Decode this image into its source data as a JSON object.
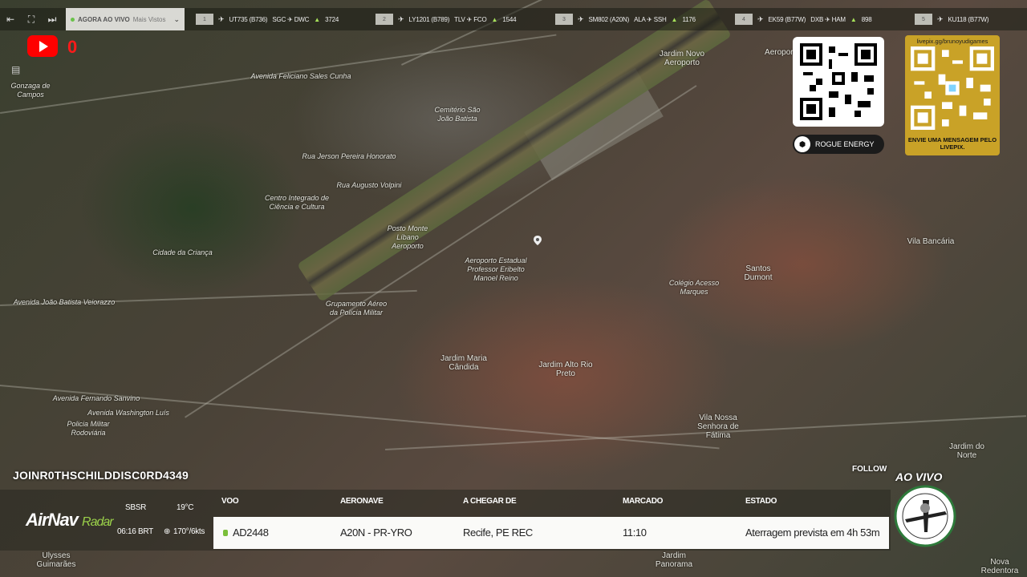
{
  "topbar": {
    "now_live_label": "AGORA AO VIVO",
    "now_live_more": "Mais Vistos",
    "flights": [
      {
        "index": "1",
        "callsign": "UT735 (B736)",
        "route": "SGC ✈ DWC",
        "altitude": "3724"
      },
      {
        "index": "2",
        "callsign": "LY1201 (B789)",
        "route": "TLV ✈ FCO",
        "altitude": "1544"
      },
      {
        "index": "3",
        "callsign": "SM802 (A20N)",
        "route": "ALA ✈ SSH",
        "altitude": "1176"
      },
      {
        "index": "4",
        "callsign": "EK59 (B77W)",
        "route": "DXB ✈ HAM",
        "altitude": "898"
      },
      {
        "index": "5",
        "callsign": "KU118 (B77W)",
        "route": "",
        "altitude": ""
      }
    ]
  },
  "youtube": {
    "count": "0"
  },
  "map_labels": [
    "Gonzaga de Campos",
    "Jardim Novo Aeroporto",
    "Avenida Feliciano Sales Cunha",
    "Cemitério São João Batista",
    "Centro Integrado de Ciência e Cultura",
    "Cidade da Criança",
    "Posto Monte Líbano Aeroporto",
    "Aeroporto Estadual Professor Eribelto Manoel Reino",
    "Santos Dumont",
    "Colégio Acesso Marques",
    "Vila Bancária",
    "Grupamento Aéreo da Polícia Militar",
    "Jardim Maria Cândida",
    "Jardim Alto Rio Preto",
    "Vila Nossa Senhora de Fátima",
    "Avenida Fernando Sanvino",
    "Jardim do Norte",
    "Jardim Panorama",
    "Nova Redentora",
    "Ulysses Guimarães",
    "Avenida João Batista Veiorazzo",
    "Rua Jerson Pereira Honorato",
    "Rua Augusto Volpini",
    "Policia Militar Rodoviária",
    "Avenida Washington Luís",
    "Aeroporto"
  ],
  "qr": {
    "sponsor": "ROGUE ENERGY",
    "livepix_url": "livepix.gg/brunoyudigames",
    "livepix_message": "ENVIE UMA MENSAGEM PELO LIVEPIX."
  },
  "stream": {
    "username": "JOINR0THSCHILDDISC0RD4349",
    "follow": "FOLLOW",
    "live_label": "AO VIVO"
  },
  "airnav": {
    "brand_main": "AirNav",
    "brand_sub": "Radar",
    "airport": "SBSR",
    "time": "06:16 BRT",
    "temperature": "19°C",
    "wind": "170°/6kts"
  },
  "flight_table": {
    "headers": {
      "flight": "VOO",
      "aircraft": "AERONAVE",
      "arriving_from": "A CHEGAR DE",
      "scheduled": "MARCADO",
      "status": "ESTADO"
    },
    "row": {
      "flight": "AD2448",
      "aircraft": "A20N - PR-YRO",
      "arriving_from": "Recife, PE REC",
      "scheduled": "11:10",
      "status": "Aterragem prevista em 4h 53m"
    }
  },
  "colors": {
    "accent_green": "#9bd24a",
    "youtube_red": "#ff0000",
    "livepix_gold": "#c9a227"
  }
}
